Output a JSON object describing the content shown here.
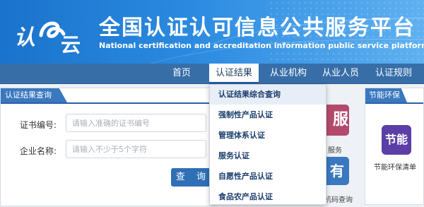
{
  "header": {
    "logo_char1": "认",
    "logo_char2": "云",
    "title": "全国认证认可信息公共服务平台",
    "subtitle": "National certification and accreditation information public service platform"
  },
  "nav": {
    "items": [
      {
        "label": "首页"
      },
      {
        "label": "认证结果"
      },
      {
        "label": "从业机构"
      },
      {
        "label": "从业人员"
      },
      {
        "label": "认证规则"
      }
    ],
    "active_index": 1
  },
  "query_panel": {
    "title": "认证结果查询",
    "cert_label": "证书编号:",
    "cert_placeholder": "请输入准确的证书编号",
    "company_label": "企业名称:",
    "company_placeholder": "请输入不少于5个字符",
    "search_label": "查 询"
  },
  "dropdown": {
    "items": [
      "认证结果综合查询",
      "强制性产品认证",
      "管理体系认证",
      "服务认证",
      "自愿性产品认证",
      "食品农产品认证"
    ]
  },
  "tiles": {
    "service": {
      "glyph": "服",
      "caption": "服务",
      "color": "#b34a6c"
    },
    "organic": {
      "glyph": "有机",
      "caption": "机码查询",
      "color": "#3a78bf"
    }
  },
  "eco_panel": {
    "title": "节能环保",
    "tile_text": "节能",
    "tile_label": "节能环保清单",
    "tile_color": "#5b3fa6"
  },
  "colors": {
    "banner": "#2b8ae0",
    "navbar": "#376ea8",
    "accent": "#2e6fb5"
  }
}
